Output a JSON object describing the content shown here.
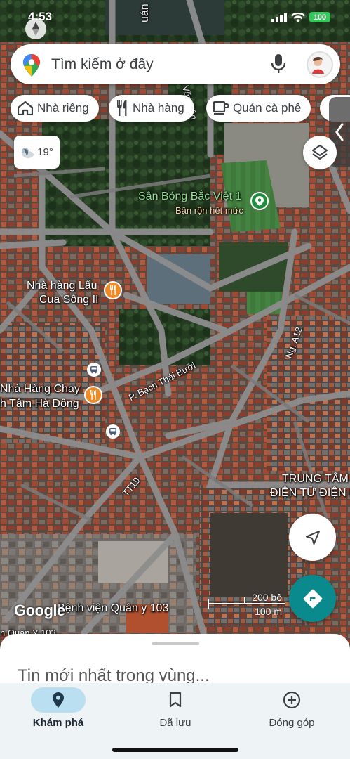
{
  "status_bar": {
    "time": "4:53",
    "battery": "100"
  },
  "search": {
    "placeholder": "Tìm kiếm ở đây"
  },
  "chips": [
    {
      "label": "Nhà riêng",
      "icon": "home-icon"
    },
    {
      "label": "Nhà hàng",
      "icon": "restaurant-icon"
    },
    {
      "label": "Quán cà phê",
      "icon": "coffee-icon"
    }
  ],
  "weather": {
    "temperature": "19°",
    "icon": "partly-cloudy-icon"
  },
  "map": {
    "labels": {
      "street_van_yen": "Hồ Văn Yên",
      "stadium_name": "Sân Bóng Bắc Việt 1",
      "stadium_status": "Bận rộn hết mức",
      "restaurant1_line1": "Nhà hàng Lẩu",
      "restaurant1_line2": "Cua Sông II",
      "restaurant2_line1": "Nhà Hàng Chay",
      "restaurant2_line2": "h Tâm Hà Đông",
      "street_bach_thai_buoi": "P. Bạch Thái Bưởi",
      "street_ng_a12": "Ng. A12",
      "street_tt19": "TT19",
      "center_line1": "TRUNG TÂM",
      "center_line2": "ĐIỆN TỬ ĐIỆN LẠ",
      "hospital": "Bệnh viện Quân y 103",
      "hospital2": "n Quân Y 103",
      "top_fragment": "uán"
    },
    "scale": {
      "top": "200 bộ",
      "bottom": "100 m"
    },
    "attribution": "Google"
  },
  "sheet": {
    "title": "Tin mới nhất trong vùng..."
  },
  "nav": [
    {
      "label": "Khám phá",
      "icon": "explore-pin-icon",
      "active": true
    },
    {
      "label": "Đã lưu",
      "icon": "bookmark-icon",
      "active": false
    },
    {
      "label": "Đóng góp",
      "icon": "add-circle-icon",
      "active": false
    }
  ],
  "colors": {
    "accent": "#0b8a8d",
    "nav_active": "#b9dff0",
    "marker_orange": "#f08a24",
    "marker_green": "#1e8e3e"
  }
}
